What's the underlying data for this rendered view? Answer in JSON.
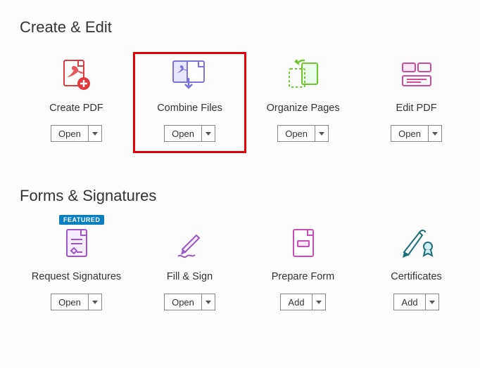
{
  "sections": {
    "create_edit": {
      "title": "Create & Edit",
      "tools": [
        {
          "label": "Create PDF",
          "button": "Open"
        },
        {
          "label": "Combine Files",
          "button": "Open"
        },
        {
          "label": "Organize Pages",
          "button": "Open"
        },
        {
          "label": "Edit PDF",
          "button": "Open"
        }
      ]
    },
    "forms_sigs": {
      "title": "Forms & Signatures",
      "tools": [
        {
          "label": "Request Signatures",
          "button": "Open",
          "badge": "FEATURED"
        },
        {
          "label": "Fill & Sign",
          "button": "Open"
        },
        {
          "label": "Prepare Form",
          "button": "Add"
        },
        {
          "label": "Certificates",
          "button": "Add"
        }
      ]
    }
  }
}
